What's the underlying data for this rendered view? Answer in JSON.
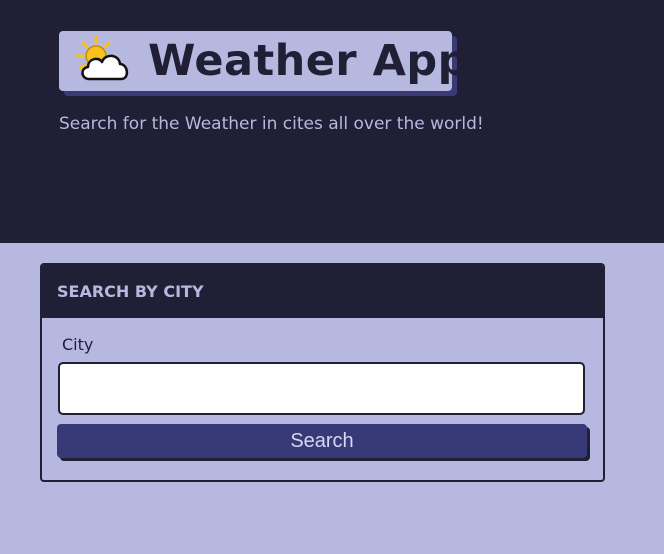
{
  "header": {
    "app_title": "Weather App",
    "subtitle": "Search for the Weather in cites all over the world!",
    "logo_icon": "sun-behind-cloud-icon"
  },
  "search": {
    "card_title": "SEARCH BY CITY",
    "city_label": "City",
    "city_value": "",
    "city_placeholder": "",
    "button_label": "Search"
  },
  "colors": {
    "dark_navy": "#211f36",
    "lavender": "#b6b8e0",
    "button_blue": "#383a77",
    "shadow_blue": "#3a3b74"
  }
}
